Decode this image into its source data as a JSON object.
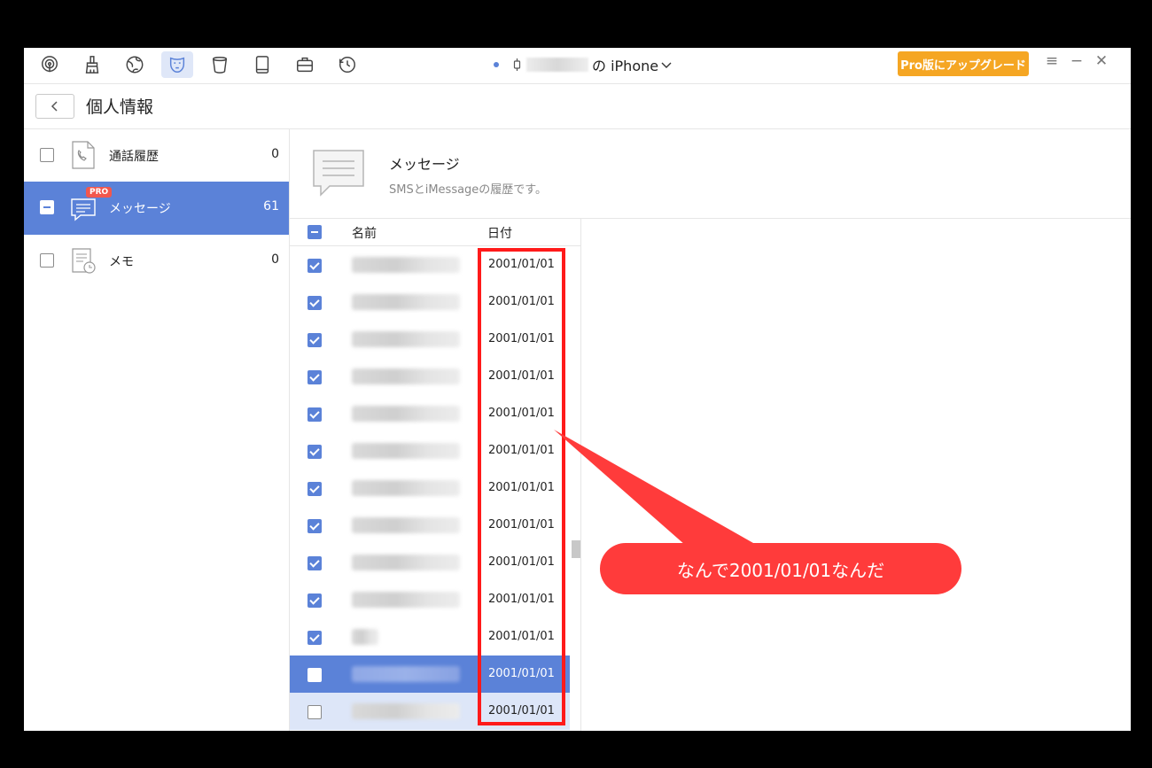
{
  "toolbar": {
    "icons": [
      "airdrop-icon",
      "broom-icon",
      "globe-icon",
      "mask-icon",
      "trash-icon",
      "tablet-icon",
      "toolbox-icon",
      "history-icon"
    ],
    "device_suffix": "の iPhone",
    "upgrade_label": "Pro版にアップグレード",
    "menu": "≡",
    "minimize": "−",
    "close": "✕"
  },
  "header": {
    "back": "<",
    "title": "個人情報"
  },
  "categories": [
    {
      "label": "通話履歴",
      "count": "0",
      "state": "unchecked",
      "icon": "phone-doc-icon"
    },
    {
      "label": "メッセージ",
      "count": "61",
      "state": "partial",
      "icon": "message-icon",
      "badge": "PRO"
    },
    {
      "label": "メモ",
      "count": "0",
      "state": "unchecked",
      "icon": "memo-icon"
    }
  ],
  "section": {
    "title": "メッセージ",
    "subtitle": "SMSとiMessageの履歴です。"
  },
  "table": {
    "col_name": "名前",
    "col_date": "日付",
    "rows": [
      {
        "date": "2001/01/01",
        "state": "checked"
      },
      {
        "date": "2001/01/01",
        "state": "checked"
      },
      {
        "date": "2001/01/01",
        "state": "checked"
      },
      {
        "date": "2001/01/01",
        "state": "checked"
      },
      {
        "date": "2001/01/01",
        "state": "checked"
      },
      {
        "date": "2001/01/01",
        "state": "checked"
      },
      {
        "date": "2001/01/01",
        "state": "checked"
      },
      {
        "date": "2001/01/01",
        "state": "checked"
      },
      {
        "date": "2001/01/01",
        "state": "checked"
      },
      {
        "date": "2001/01/01",
        "state": "checked"
      },
      {
        "date": "2001/01/01",
        "state": "checked"
      },
      {
        "date": "2001/01/01",
        "state": "unchecked-selected"
      },
      {
        "date": "2001/01/01",
        "state": "unchecked-hover"
      }
    ]
  },
  "annotation": {
    "text": "なんで2001/01/01なんだ"
  },
  "colors": {
    "accent": "#5b82d8",
    "upgrade": "#f5a623",
    "annotation_red": "#ff3b3b"
  }
}
